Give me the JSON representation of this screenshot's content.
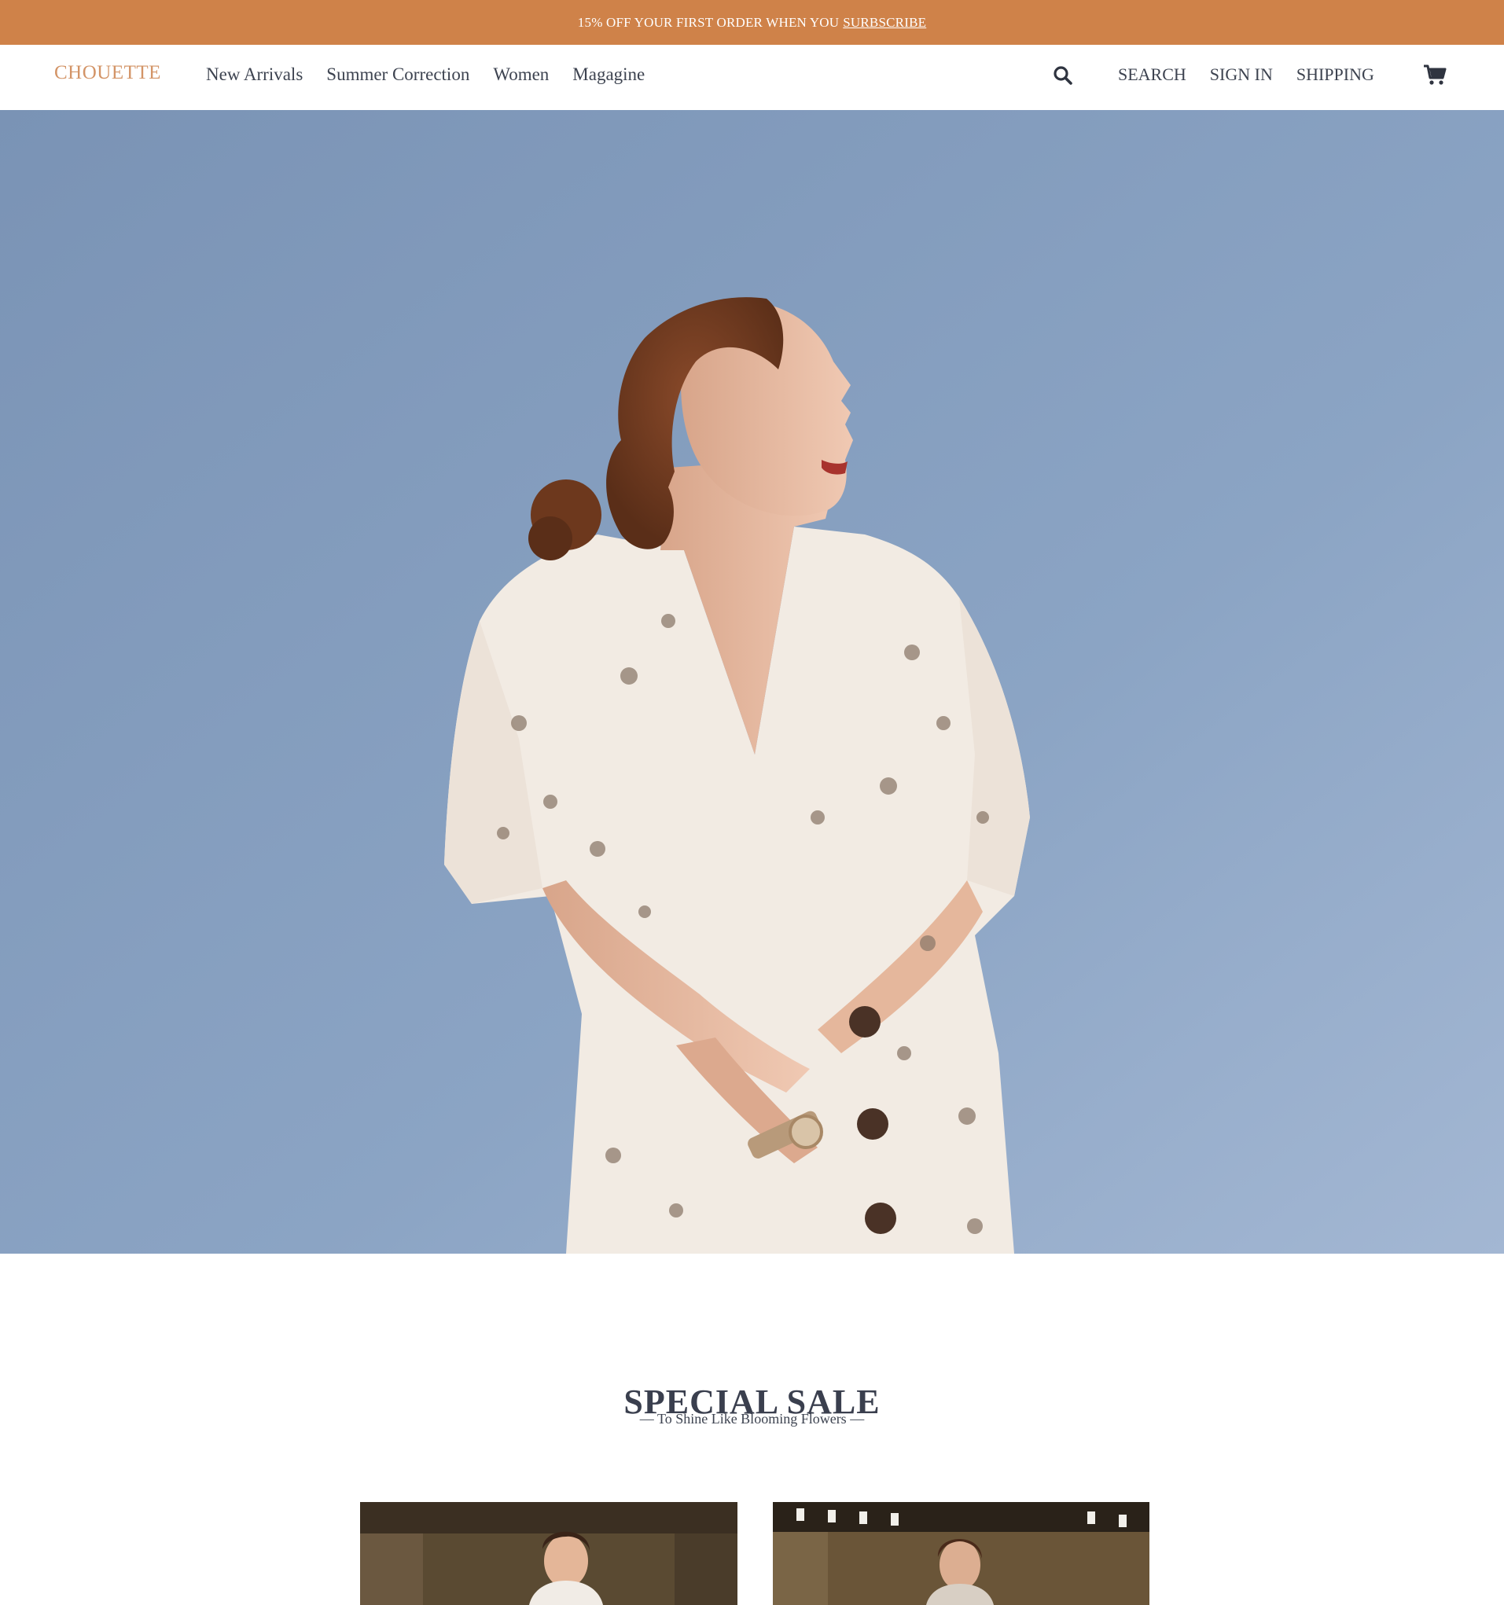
{
  "promo": {
    "text": "15% OFF YOUR FIRST ORDER WHEN YOU",
    "link": "SURBSCRIBE"
  },
  "header": {
    "logo": "CHOUETTE",
    "nav": [
      {
        "label": "New Arrivals"
      },
      {
        "label": "Summer Correction"
      },
      {
        "label": "Women"
      },
      {
        "label": "Magagine"
      }
    ],
    "search_icon": "search-icon",
    "utility": [
      {
        "label": "SEARCH"
      },
      {
        "label": "SIGN IN"
      },
      {
        "label": "SHIPPING"
      }
    ],
    "cart_icon": "cart-icon"
  },
  "hero": {
    "image": "woman-floral-dress-against-sky"
  },
  "sale": {
    "title": "SPECIAL SALE",
    "subtitle": "— To Shine Like Blooming Flowers —",
    "products": [
      {
        "image": "woman-white-outfit-in-store"
      },
      {
        "image": "woman-in-store-with-track-lights"
      }
    ]
  },
  "colors": {
    "promo_bg": "#cf8249",
    "logo": "#d39467",
    "text": "#3d4350",
    "sky": "#8ea6c5"
  }
}
